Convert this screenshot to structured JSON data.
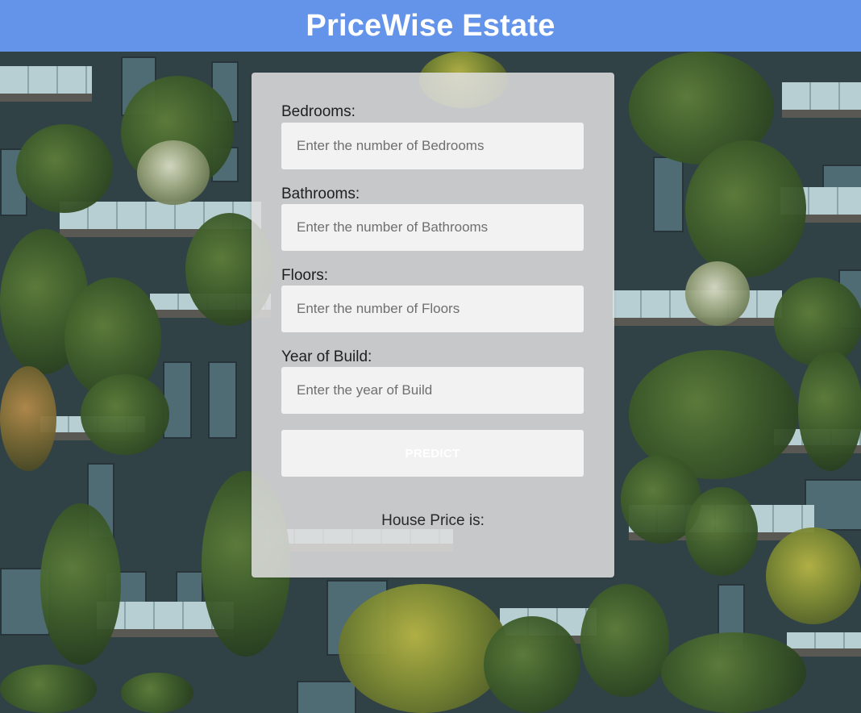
{
  "header": {
    "title": "PriceWise Estate"
  },
  "form": {
    "fields": [
      {
        "label": "Bedrooms:",
        "placeholder": "Enter the number of Bedrooms"
      },
      {
        "label": "Bathrooms:",
        "placeholder": "Enter the number of Bathrooms"
      },
      {
        "label": "Floors:",
        "placeholder": "Enter the number of Floors"
      },
      {
        "label": "Year of Build:",
        "placeholder": "Enter the year of Build"
      }
    ],
    "predict_label": "PREDICT",
    "result_label": "House Price is:"
  },
  "colors": {
    "header_bg": "#6493ea",
    "header_text": "#ffffff",
    "card_bg": "#dedede",
    "input_bg": "#f2f2f2"
  }
}
